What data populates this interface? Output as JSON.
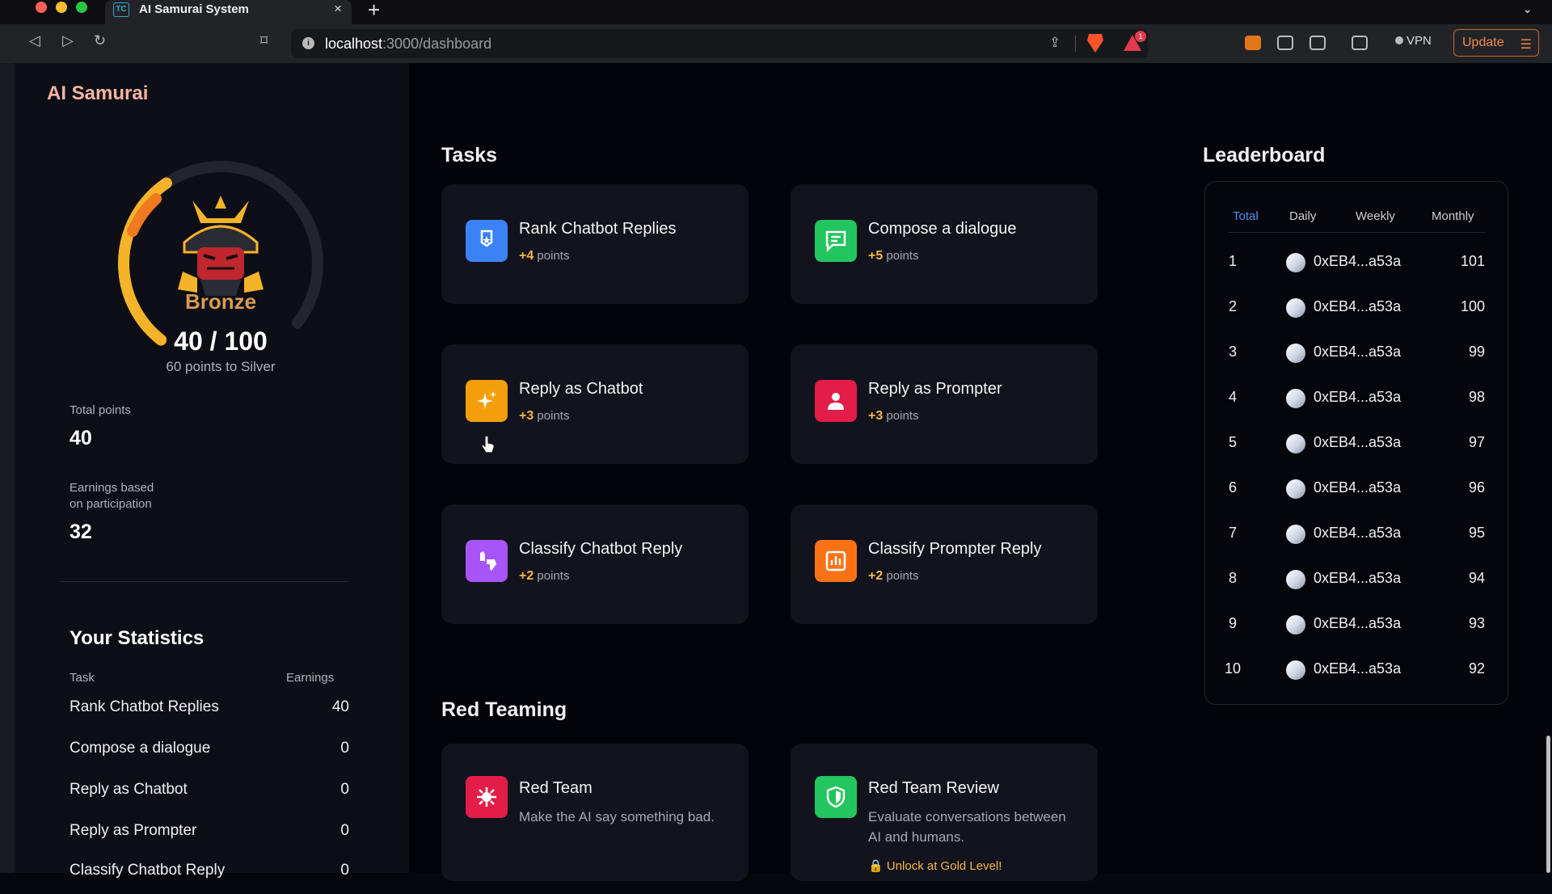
{
  "browser": {
    "tab_favicon": "TC",
    "tab_title": "AI Samurai System",
    "tab_close": "×",
    "new_tab": "+",
    "url_host": "localhost",
    "url_path": ":3000/dashboard",
    "vpn_label": "VPN",
    "update_label": "Update",
    "reward_badge": "1"
  },
  "app": {
    "brand": "AI Samurai",
    "rank": {
      "name": "Bronze",
      "progress": "40 / 100",
      "progress_fraction": 0.4,
      "subtitle": "60 points to Silver"
    },
    "total_points_label": "Total points",
    "total_points_value": "40",
    "earnings_label_1": "Earnings based",
    "earnings_label_2": "on participation",
    "earnings_value": "32",
    "stats": {
      "title": "Your Statistics",
      "col_task": "Task",
      "col_earnings": "Earnings",
      "rows": [
        {
          "task": "Rank Chatbot Replies",
          "value": "40"
        },
        {
          "task": "Compose a dialogue",
          "value": "0"
        },
        {
          "task": "Reply as Chatbot",
          "value": "0"
        },
        {
          "task": "Reply as Prompter",
          "value": "0"
        },
        {
          "task": "Classify Chatbot Reply",
          "value": "0"
        }
      ]
    }
  },
  "tasks": {
    "title": "Tasks",
    "points_word": "points",
    "cards": [
      {
        "title": "Rank Chatbot Replies",
        "points": "+4",
        "icon": "medal-icon",
        "color": "#3b82f6"
      },
      {
        "title": "Compose a dialogue",
        "points": "+5",
        "icon": "chat-icon",
        "color": "#22c55e"
      },
      {
        "title": "Reply as Chatbot",
        "points": "+3",
        "icon": "sparkles-icon",
        "color": "#f59e0b"
      },
      {
        "title": "Reply as Prompter",
        "points": "+3",
        "icon": "user-icon",
        "color": "#e11d48"
      },
      {
        "title": "Classify Chatbot Reply",
        "points": "+2",
        "icon": "thumbs-icon",
        "color": "#a855f7"
      },
      {
        "title": "Classify Prompter Reply",
        "points": "+2",
        "icon": "bar-chart-icon",
        "color": "#f97316"
      }
    ]
  },
  "red_teaming": {
    "title": "Red Teaming",
    "cards": [
      {
        "title": "Red Team",
        "desc": "Make the AI say something bad.",
        "icon": "virus-icon",
        "color": "#e11d48"
      },
      {
        "title": "Red Team Review",
        "desc": "Evaluate conversations between AI and humans.",
        "lock": "Unlock at Gold Level!",
        "icon": "shield-icon",
        "color": "#22c55e"
      }
    ]
  },
  "leaderboard": {
    "title": "Leaderboard",
    "tabs": [
      "Total",
      "Daily",
      "Weekly",
      "Monthly"
    ],
    "active_tab": "Total",
    "accent": "#4e8ff7",
    "rows": [
      {
        "rank": "1",
        "address": "0xEB4...a53a",
        "score": "101"
      },
      {
        "rank": "2",
        "address": "0xEB4...a53a",
        "score": "100"
      },
      {
        "rank": "3",
        "address": "0xEB4...a53a",
        "score": "99"
      },
      {
        "rank": "4",
        "address": "0xEB4...a53a",
        "score": "98"
      },
      {
        "rank": "5",
        "address": "0xEB4...a53a",
        "score": "97"
      },
      {
        "rank": "6",
        "address": "0xEB4...a53a",
        "score": "96"
      },
      {
        "rank": "7",
        "address": "0xEB4...a53a",
        "score": "95"
      },
      {
        "rank": "8",
        "address": "0xEB4...a53a",
        "score": "94"
      },
      {
        "rank": "9",
        "address": "0xEB4...a53a",
        "score": "93"
      },
      {
        "rank": "10",
        "address": "0xEB4...a53a",
        "score": "92"
      }
    ]
  }
}
